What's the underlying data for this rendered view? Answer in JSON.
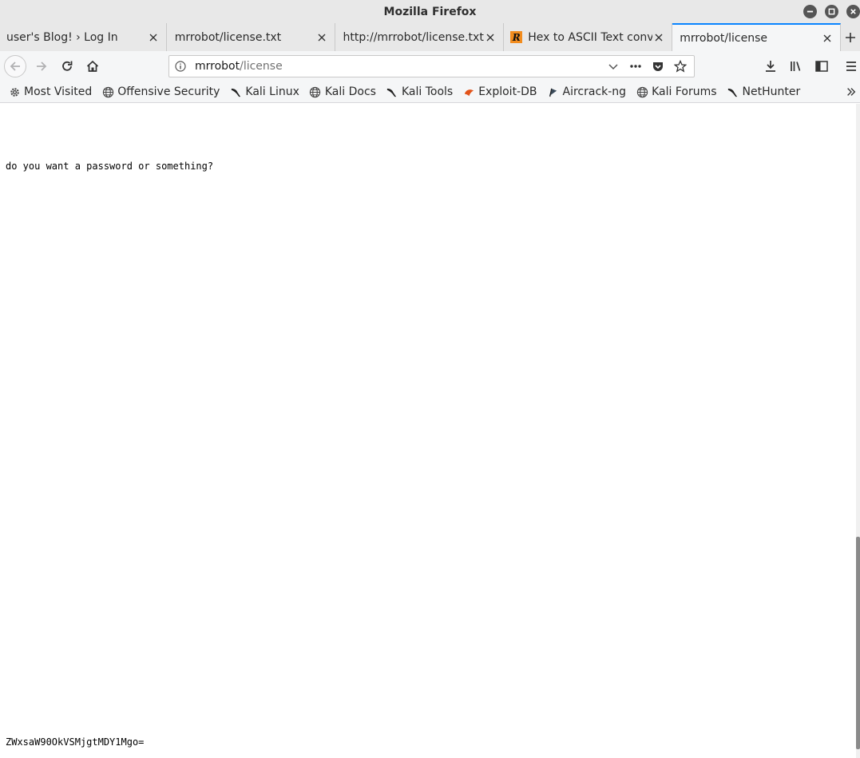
{
  "window": {
    "title": "Mozilla Firefox"
  },
  "tabs": [
    {
      "label": "user's Blog! › Log In",
      "active": false
    },
    {
      "label": "mrrobot/license.txt",
      "active": false
    },
    {
      "label": "http://mrrobot/license.txt",
      "active": false
    },
    {
      "label": "Hex to ASCII Text conve",
      "active": false,
      "favicon": "R"
    },
    {
      "label": "mrrobot/license",
      "active": true
    }
  ],
  "urlbar": {
    "host": "mrrobot",
    "path": "/license"
  },
  "bookmarks": [
    {
      "label": "Most Visited",
      "icon": "gear-icon"
    },
    {
      "label": "Offensive Security",
      "icon": "globe-icon"
    },
    {
      "label": "Kali Linux",
      "icon": "kali-dragon-icon"
    },
    {
      "label": "Kali Docs",
      "icon": "globe-icon"
    },
    {
      "label": "Kali Tools",
      "icon": "kali-dragon-icon"
    },
    {
      "label": "Exploit-DB",
      "icon": "exploit-db-icon"
    },
    {
      "label": "Aircrack-ng",
      "icon": "aircrack-icon"
    },
    {
      "label": "Kali Forums",
      "icon": "globe-icon"
    },
    {
      "label": "NetHunter",
      "icon": "kali-dragon-icon"
    }
  ],
  "page": {
    "line1": "do you want a password or something?",
    "line2": "ZWxsaW90OkVSMjgtMDY1Mgo="
  },
  "colors": {
    "accent": "#0a84ff",
    "chrome": "#e8e8e8",
    "toolbar": "#f5f6f7"
  }
}
